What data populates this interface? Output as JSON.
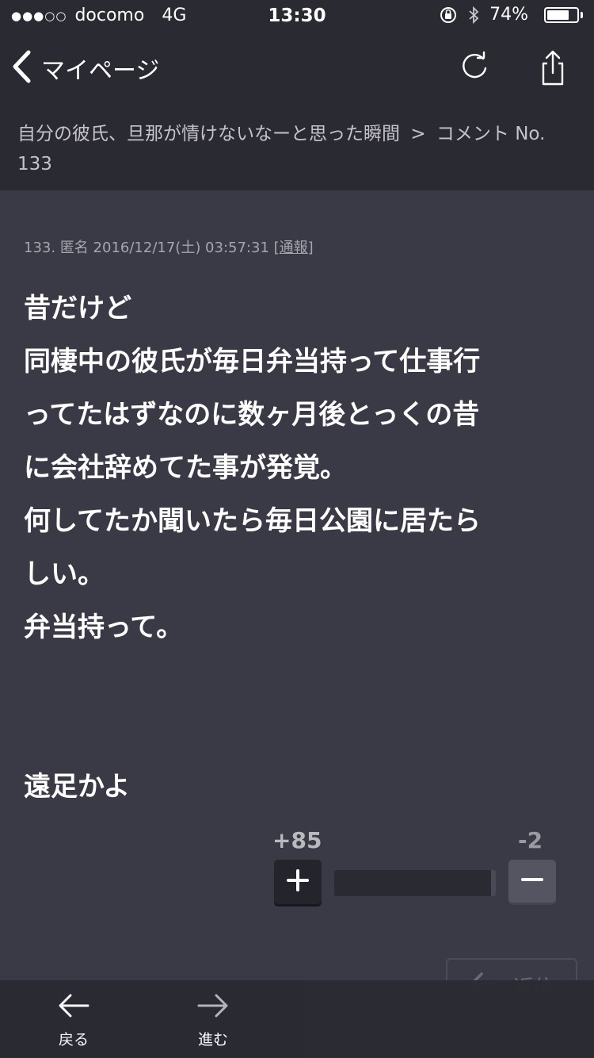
{
  "status_bar": {
    "signal": "●●●○○",
    "carrier": "docomo",
    "network": "4G",
    "time": "13:30",
    "battery_percent": "74%",
    "battery_level": 0.74
  },
  "nav": {
    "back_label": "マイページ",
    "back_icon": "chevron-left-icon",
    "refresh_icon": "refresh-icon",
    "share_icon": "share-icon"
  },
  "breadcrumb": {
    "topic": "自分の彼氏、旦那が情けないなーと思った瞬間",
    "separator": ">",
    "current_line1": "コメント No.",
    "current_line2": "133"
  },
  "comment": {
    "number": "133.",
    "author": "匿名",
    "datetime": "2016/12/17(土) 03:57:31",
    "report_open": "[",
    "report_label": "通報",
    "report_close": "]",
    "lines": [
      "昔だけど",
      "同棲中の彼氏が毎日弁当持って仕事行",
      "ってたはずなのに数ヶ月後とっくの昔",
      "に会社辞めてた事が発覚。",
      "何してたか聞いたら毎日公園に居たら",
      "しい。",
      "弁当持って。",
      "",
      "",
      "遠足かよ"
    ]
  },
  "vote": {
    "plus_count": "+85",
    "minus_count": "-2",
    "plus_icon": "plus-icon",
    "minus_icon": "minus-icon"
  },
  "reply": {
    "label": "返信",
    "icon": "reply-arrow-icon"
  },
  "toolbar": {
    "back_label": "戻る",
    "forward_label": "進む"
  },
  "colors": {
    "background": "#3a3a47",
    "header": "#2a2a33",
    "text": "#ffffff",
    "muted": "#a6a6ad"
  }
}
